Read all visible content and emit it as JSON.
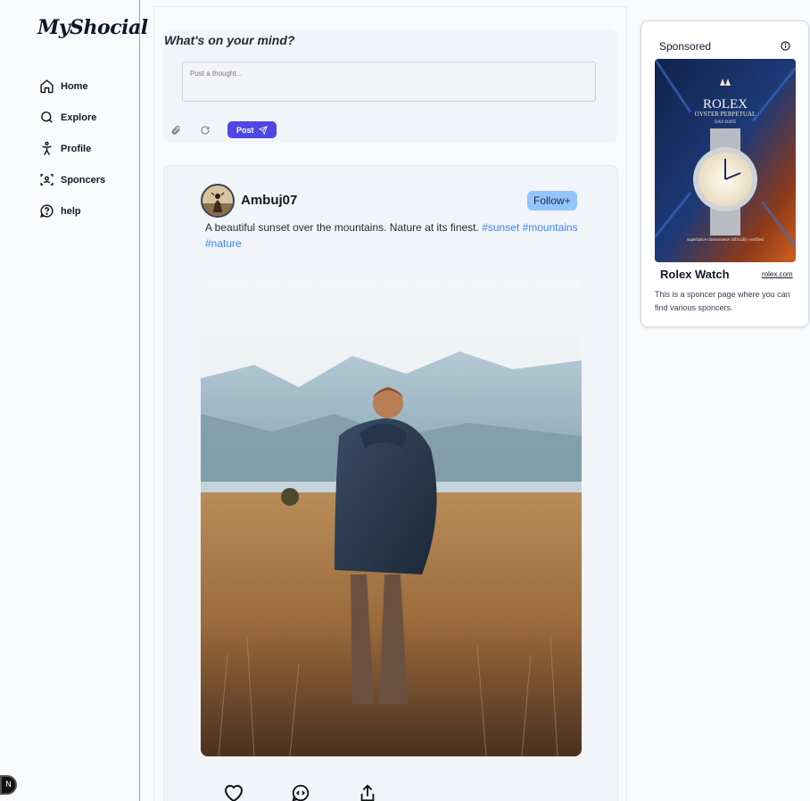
{
  "brand": {
    "logo": "MyShocial"
  },
  "sidebar": {
    "items": [
      {
        "label": "Home",
        "icon": "home-icon"
      },
      {
        "label": "Explore",
        "icon": "search-icon"
      },
      {
        "label": "Profile",
        "icon": "person-icon"
      },
      {
        "label": "Sponcers",
        "icon": "scan-user-icon"
      },
      {
        "label": "help",
        "icon": "help-bubble-icon"
      }
    ]
  },
  "devtools": {
    "badge": "N"
  },
  "composer": {
    "title": "What's on your mind?",
    "placeholder": "Post a thought...",
    "post_label": "Post",
    "attach_icon": "paperclip-icon",
    "refresh_icon": "refresh-icon",
    "send_icon": "send-icon"
  },
  "post": {
    "username": "Ambuj07",
    "follow_label": "Follow+",
    "caption": "A beautiful sunset over the mountains. Nature at its finest.",
    "tags": [
      "#sunset",
      "#mountains",
      "#nature"
    ],
    "image_alt": "man-in-field-mountains-photo",
    "actions": [
      "heart-icon",
      "comment-icon",
      "share-icon"
    ]
  },
  "sponsor": {
    "title": "Sponsored",
    "info_icon": "info-icon",
    "ad_brand": "ROLEX",
    "ad_line1": "OYSTER PERPETUAL",
    "ad_line2": "DAY-DATE",
    "ad_footer": "superlative chronometer officially certified",
    "name": "Rolex Watch",
    "link": "rolex.com",
    "description": "This is a sponcer page where you can find various sponcers."
  },
  "colors": {
    "accent": "#4f46e5",
    "follow": "#93c5fd",
    "tag": "#3b82f6"
  }
}
